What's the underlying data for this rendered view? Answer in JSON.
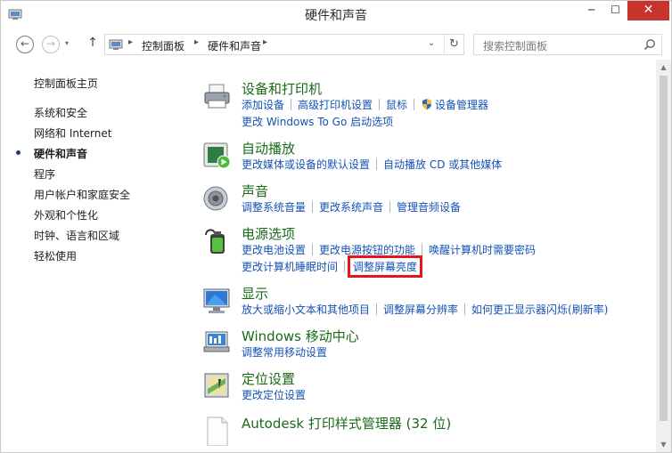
{
  "window": {
    "title": "硬件和声音",
    "controls": {
      "minimize": "─",
      "maximize": "☐",
      "close": "✕"
    }
  },
  "nav": {
    "back": "←",
    "forward": "→",
    "up": "↑",
    "breadcrumb": [
      "控制面板",
      "硬件和声音"
    ],
    "sep": "▸",
    "dropdown": "⌄",
    "refresh": "↻",
    "search_placeholder": "搜索控制面板"
  },
  "sidebar": {
    "home": "控制面板主页",
    "items": [
      "系统和安全",
      "网络和 Internet",
      "硬件和声音",
      "程序",
      "用户帐户和家庭安全",
      "外观和个性化",
      "时钟、语言和区域",
      "轻松使用"
    ],
    "active_index": 2
  },
  "categories": {
    "devices": {
      "title": "设备和打印机",
      "links1": [
        "添加设备",
        "高级打印机设置",
        "鼠标",
        "设备管理器"
      ],
      "links2": [
        "更改 Windows To Go 启动选项"
      ]
    },
    "autoplay": {
      "title": "自动播放",
      "links1": [
        "更改媒体或设备的默认设置",
        "自动播放 CD 或其他媒体"
      ]
    },
    "sound": {
      "title": "声音",
      "links1": [
        "调整系统音量",
        "更改系统声音",
        "管理音频设备"
      ]
    },
    "power": {
      "title": "电源选项",
      "links1": [
        "更改电池设置",
        "更改电源按钮的功能",
        "唤醒计算机时需要密码"
      ],
      "links2": [
        "更改计算机睡眠时间",
        "调整屏幕亮度"
      ]
    },
    "display": {
      "title": "显示",
      "links1": [
        "放大或缩小文本和其他项目",
        "调整屏幕分辨率",
        "如何更正显示器闪烁(刷新率)"
      ]
    },
    "mobility": {
      "title": "Windows 移动中心",
      "links1": [
        "调整常用移动设置"
      ]
    },
    "location": {
      "title": "定位设置",
      "links1": [
        "更改定位设置"
      ]
    },
    "autodesk": {
      "title": "Autodesk 打印样式管理器 (32 位)"
    }
  },
  "colors": {
    "link": "#1552b6",
    "category_title": "#1a6a1a",
    "highlight_box": "#e0181c",
    "close_button": "#c7342d"
  },
  "icons": [
    "control-panel-icon",
    "back-icon",
    "forward-icon",
    "up-icon",
    "refresh-icon",
    "search-icon",
    "printer-icon",
    "autoplay-icon",
    "speaker-icon",
    "battery-icon",
    "monitor-icon",
    "mobility-center-icon",
    "location-icon",
    "document-icon",
    "shield-icon"
  ]
}
